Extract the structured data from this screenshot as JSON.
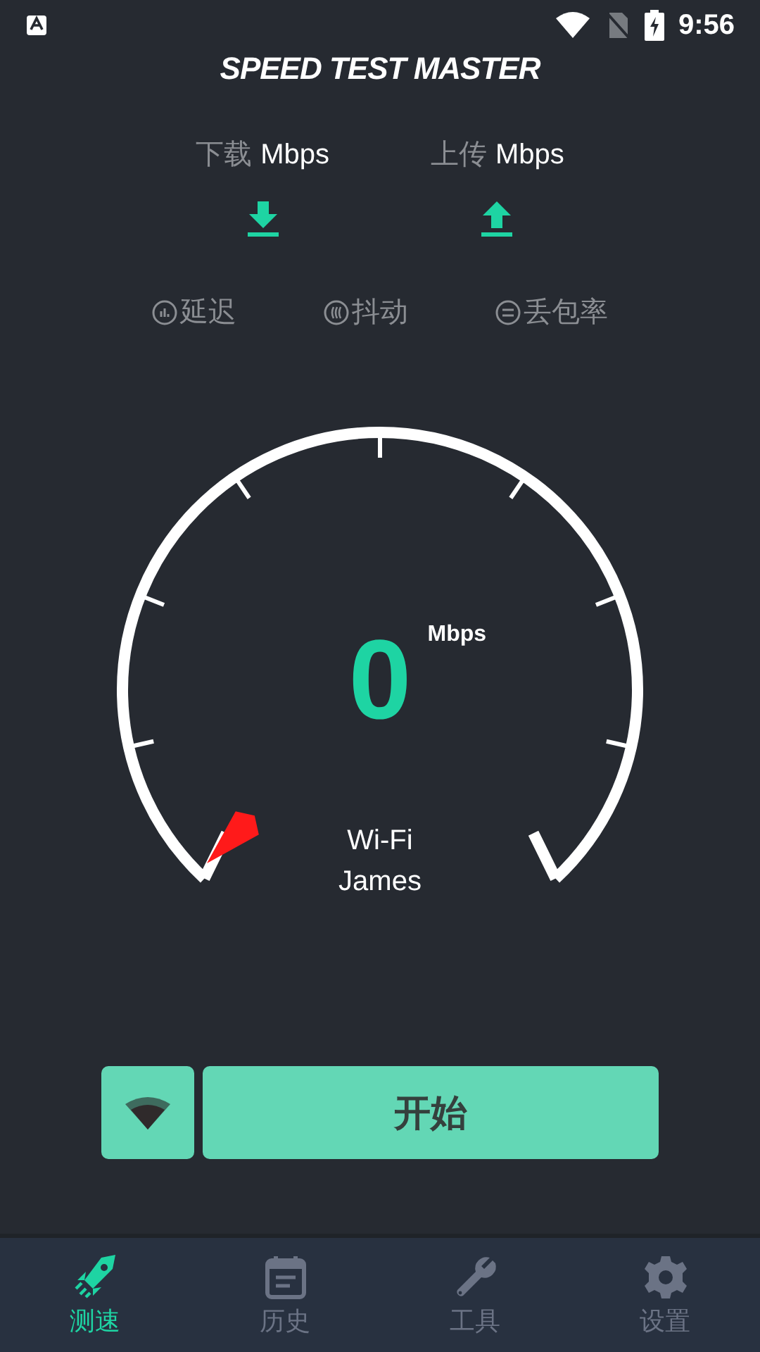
{
  "status_bar": {
    "time": "9:56"
  },
  "title": "SPEED TEST MASTER",
  "rates": [
    {
      "kind": "download",
      "label": "下载",
      "unit": "Mbps"
    },
    {
      "kind": "upload",
      "label": "上传",
      "unit": "Mbps"
    }
  ],
  "metrics": [
    {
      "kind": "latency",
      "label": "延迟"
    },
    {
      "kind": "jitter",
      "label": "抖动"
    },
    {
      "kind": "loss",
      "label": "丢包率"
    }
  ],
  "gauge": {
    "value": "0",
    "unit": "Mbps",
    "network": "Wi-Fi",
    "name": "James"
  },
  "start_button": "开始",
  "nav": [
    {
      "kind": "speed",
      "label": "测速",
      "selected": true
    },
    {
      "kind": "history",
      "label": "历史",
      "selected": false
    },
    {
      "kind": "tools",
      "label": "工具",
      "selected": false
    },
    {
      "kind": "settings",
      "label": "设置",
      "selected": false
    }
  ]
}
